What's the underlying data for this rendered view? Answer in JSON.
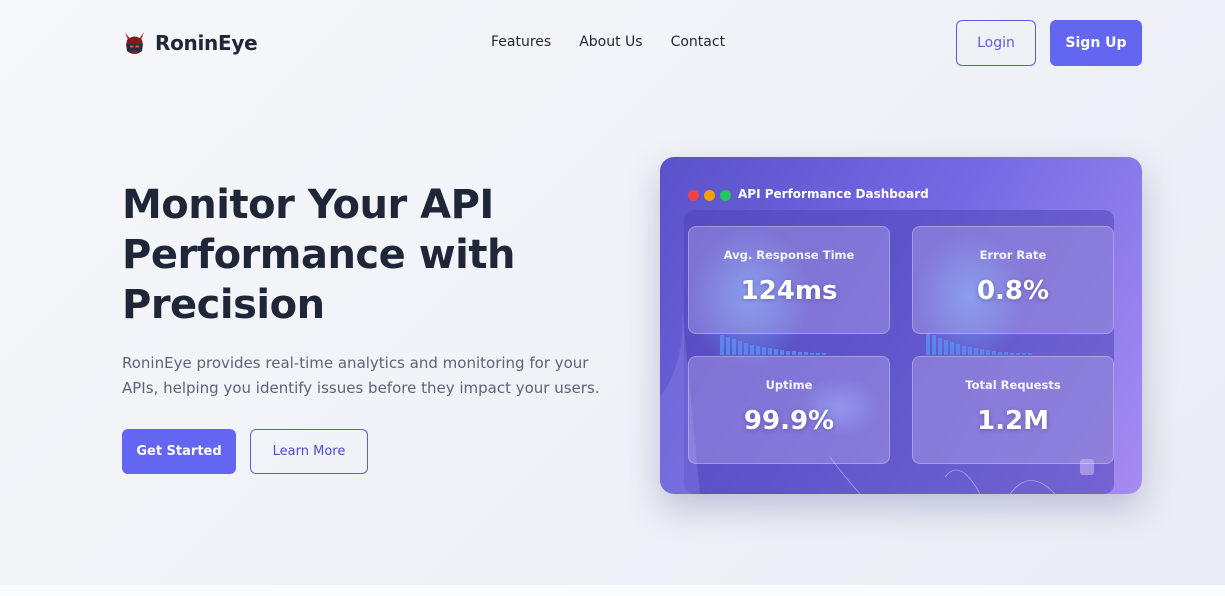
{
  "brand": {
    "name": "RoninEye",
    "logo_icon": "ronin-helmet-icon"
  },
  "nav": {
    "links": [
      "Features",
      "About Us",
      "Contact"
    ]
  },
  "header": {
    "login_label": "Login",
    "signup_label": "Sign Up"
  },
  "hero": {
    "title": "Monitor Your API Performance with Precision",
    "description": "RoninEye provides real-time analytics and monitoring for your APIs, helping you identify issues before they impact your users.",
    "cta_primary": "Get Started",
    "cta_secondary": "Learn More"
  },
  "dashboard": {
    "title": "API Performance Dashboard",
    "window_dots": [
      "#ef4444",
      "#f59e0b",
      "#22c55e"
    ],
    "metrics": [
      {
        "label": "Avg. Response Time",
        "value": "124ms"
      },
      {
        "label": "Error Rate",
        "value": "0.8%"
      },
      {
        "label": "Uptime",
        "value": "99.9%"
      },
      {
        "label": "Total Requests",
        "value": "1.2M"
      }
    ]
  },
  "colors": {
    "accent": "#6366f1",
    "text": "#1e2637",
    "muted": "#5c6577"
  }
}
